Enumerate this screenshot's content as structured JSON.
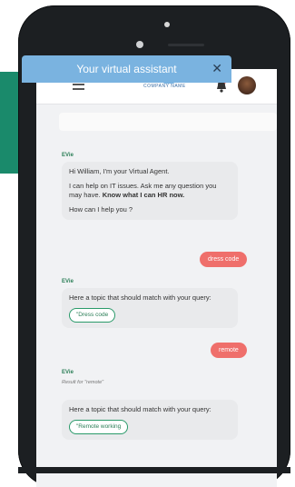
{
  "header": {
    "title": "Your virtual assistant",
    "close_glyph": "✕"
  },
  "topbar": {
    "logo_text": "COMPANY NAME",
    "icons": [
      "menu-icon",
      "bell-icon",
      "avatar"
    ]
  },
  "agent_name": "EVie",
  "messages": [
    {
      "type": "agent",
      "name": "EVie",
      "lines": [
        "Hi William, I'm your Virtual Agent.",
        "I can help on IT issues. Ask me any question you may have. ",
        "Know what I can HR now.",
        "How can I help you ?"
      ]
    },
    {
      "type": "user",
      "text": "dress code"
    },
    {
      "type": "agent",
      "name": "EVie",
      "text": "Here a topic that should match with your query:",
      "chip": "\"Dress code"
    },
    {
      "type": "user",
      "text": "remote"
    },
    {
      "type": "agent",
      "name": "EVie",
      "note": "Result for \"remote\"",
      "text": "Here a topic that should match with your query:",
      "chip": "\"Remote working"
    }
  ],
  "colors": {
    "header": "#7ab3e0",
    "user_bubble": "#ef6f6b",
    "chip_border": "#2a9a6a",
    "green_panel": "#1a8a6b"
  }
}
